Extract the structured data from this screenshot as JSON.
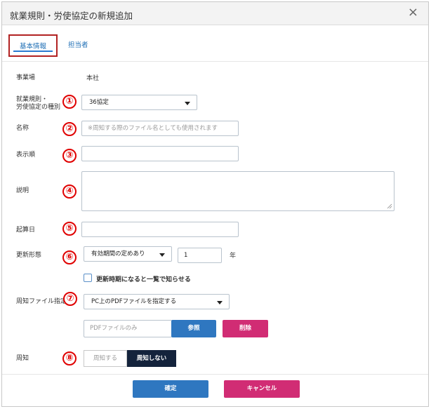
{
  "dialog": {
    "title": "就業規則・労使協定の新規追加",
    "close_glyph": "×"
  },
  "tabs": [
    {
      "label": "基本情報",
      "active": true
    },
    {
      "label": "担当者",
      "active": false
    }
  ],
  "fields": {
    "office": {
      "label": "事業場",
      "value": "本社"
    },
    "type": {
      "label_line1": "就業規則・",
      "label_line2": "労使協定の種別",
      "selected": "36協定",
      "marker": "①"
    },
    "name": {
      "label": "名称",
      "placeholder": "※周知する際のファイル名としても使用されます",
      "value": "",
      "marker": "②"
    },
    "order": {
      "label": "表示順",
      "value": "",
      "marker": "③"
    },
    "description": {
      "label": "説明",
      "value": "",
      "marker": "④"
    },
    "start_date": {
      "label": "起算日",
      "value": "",
      "marker": "⑤"
    },
    "renewal": {
      "label": "更新形態",
      "selected": "有効期間の定めあり",
      "years_value": "1",
      "unit": "年",
      "marker": "⑥"
    },
    "notify_checkbox": {
      "label": "更新時期になると一覧で知らせる",
      "checked": false
    },
    "file": {
      "label": "周知ファイル指定",
      "selected": "PC上のPDFファイルを指定する",
      "marker": "⑦",
      "file_placeholder": "PDFファイルのみ",
      "browse_label": "参照",
      "delete_label": "削除"
    },
    "publicize": {
      "label": "周知",
      "option_on": "周知する",
      "option_off": "周知しない",
      "selected": "周知しない",
      "marker": "⑧"
    }
  },
  "footer": {
    "confirm_label": "確定",
    "cancel_label": "キャンセル"
  },
  "colors": {
    "primary": "#2f77c0",
    "danger": "#d12c74",
    "toggle_active": "#14233c",
    "marker": "#e00000",
    "tab_highlight": "#b22222"
  }
}
